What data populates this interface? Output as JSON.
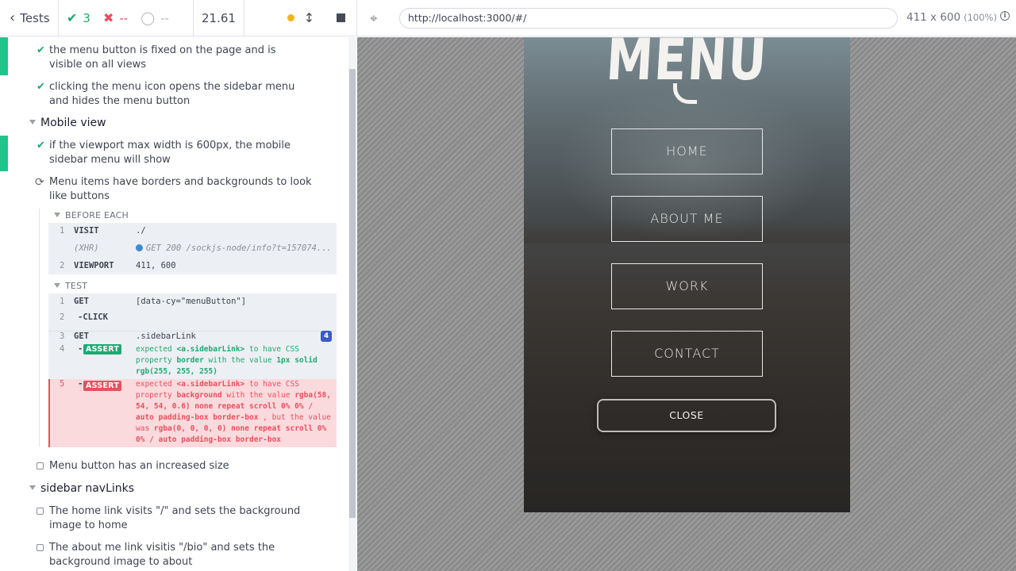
{
  "reporter": {
    "tests_label": "Tests",
    "passed": "3",
    "failed": "--",
    "pending": "--",
    "duration": "21.61"
  },
  "tests": {
    "t1": "the menu button is fixed on the page and is visible on all views",
    "t2": "clicking the menu icon opens the sidebar menu and hides the menu button",
    "suite_mobile": "Mobile view",
    "t3": "if the viewport max width is 600px, the mobile sidebar menu will show",
    "t4": "Menu items have borders and backgrounds to look like buttons",
    "before_each": "BEFORE EACH",
    "test_label": "TEST",
    "t5": "Menu button has an increased size",
    "suite_nav": "sidebar navLinks",
    "t6": "The home link visits \"/\" and sets the background image to home",
    "t7": "The about me link visitis \"/bio\" and sets the background image to about"
  },
  "before_commands": [
    {
      "num": "1",
      "name": "VISIT",
      "msg": "./"
    },
    {
      "num": "",
      "name": "(XHR)",
      "msg": "GET 200 /sockjs-node/info?t=157074..."
    },
    {
      "num": "2",
      "name": "VIEWPORT",
      "msg": "411, 600"
    }
  ],
  "test_commands": [
    {
      "num": "1",
      "name": "GET",
      "msg": "[data-cy=\"menuButton\"]"
    },
    {
      "num": "2",
      "name": "-CLICK",
      "msg": ""
    },
    {
      "num": "3",
      "name": "GET",
      "msg": ".sidebarLink",
      "count": "4"
    },
    {
      "num": "4",
      "name": "ASSERT",
      "msg": "expected <a.sidebarLink> to have CSS property border with the value 1px solid rgb(255, 255, 255)"
    },
    {
      "num": "5",
      "name": "ASSERT",
      "msg": "expected <a.sidebarLink> to have CSS property background with the value rgba(58, 54, 54, 0.6) none repeat scroll 0% 0% / auto padding-box border-box , but the value was rgba(0, 0, 0, 0) none repeat scroll 0% 0% / auto padding-box border-box"
    }
  ],
  "assert4": {
    "p1": "expected ",
    "el": "<a.sidebarLink>",
    "p2": " to have CSS property ",
    "prop": "border",
    "p3": " with the value ",
    "val": "1px solid rgb(255, 255, 255)"
  },
  "assert5": {
    "p1": "expected ",
    "el": "<a.sidebarLink>",
    "p2": " to have CSS property ",
    "prop": "background",
    "p3": " with the value ",
    "val": "rgba(58, 54, 54, 0.6) none repeat scroll 0% 0% / auto padding-box border-box",
    "p4": " , but the value was ",
    "actual": "rgba(0, 0, 0, 0) none repeat scroll 0% 0% / auto padding-box border-box"
  },
  "aut": {
    "url": "http://localhost:3000/#/",
    "viewport": "411 x 600",
    "zoom": "(100%)"
  },
  "app": {
    "title": "MENU",
    "links": [
      "HOME",
      "ABOUT ME",
      "WORK",
      "CONTACT"
    ],
    "close": "CLOSE"
  },
  "colors": {
    "pass": "#1fa971",
    "fail": "#e94f5f",
    "running": "#f1b21f",
    "badge": "#3a5bc7"
  }
}
